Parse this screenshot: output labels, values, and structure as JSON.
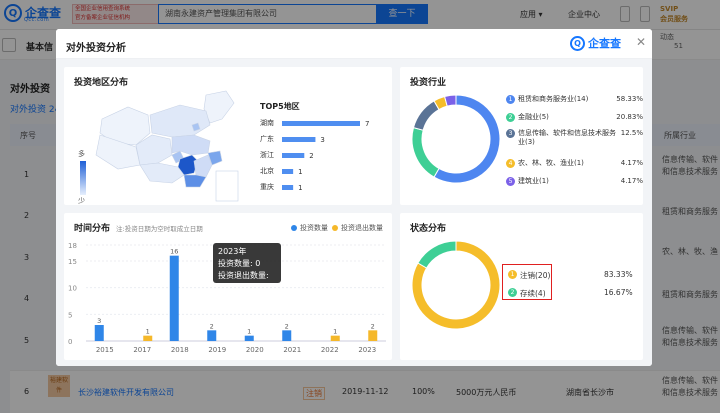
{
  "topbar": {
    "logo_text": "企查查",
    "logo_sub": "Qcc.com",
    "badge_line1": "全国企业信用查询系统",
    "badge_line2": "官方备案企业征信机构",
    "search_value": "湖南永建资产管理集团有限公司",
    "search_button": "查一下",
    "nav_app": "应用",
    "nav_enterprise": "企业中心",
    "svip_line1": "SVIP",
    "svip_line2": "会员服务"
  },
  "background": {
    "basic_info_tab": "基本信",
    "dynamic_label": "动态",
    "dynamic_count": "51",
    "section_title": "对外投资",
    "subtab": "对外投资 24",
    "col_seq": "序号",
    "col_industry": "所属行业",
    "rows": [
      {
        "num": "1",
        "industry": "信息传输、软件和信息技术服务"
      },
      {
        "num": "2",
        "industry": "租赁和商务服务"
      },
      {
        "num": "3",
        "industry": "农、林、牧、渔"
      },
      {
        "num": "4",
        "industry": "租赁和商务服务"
      },
      {
        "num": "5",
        "industry": "信息传输、软件和信息技术服务"
      }
    ],
    "row6": {
      "num": "6",
      "logo": "裕建软件",
      "name": "长沙裕建软件开发有限公司",
      "status": "注销",
      "date": "2019-11-12",
      "ratio": "100%",
      "capital": "5000万元人民币",
      "region": "湖南省长沙市",
      "industry": "信息传输、软件和信息技术服务"
    }
  },
  "modal": {
    "title": "对外投资分析",
    "logo_text": "企查查",
    "close_icon": "close-icon"
  },
  "region": {
    "title": "投资地区分布",
    "legend_high": "多",
    "legend_low": "少",
    "top5_title": "TOP5地区",
    "top5": [
      {
        "name": "湖南",
        "value": 7
      },
      {
        "name": "广东",
        "value": 3
      },
      {
        "name": "浙江",
        "value": 2
      },
      {
        "name": "北京",
        "value": 1
      },
      {
        "name": "重庆",
        "value": 1
      }
    ],
    "map_color": "#4f8ef0"
  },
  "industry": {
    "title": "投资行业",
    "items": [
      {
        "num": "1",
        "label": "租赁和商务服务业(14)",
        "pct": "58.33%",
        "value": 14,
        "color": "#4e86f0"
      },
      {
        "num": "2",
        "label": "金融业(5)",
        "pct": "20.83%",
        "value": 5,
        "color": "#3ecf95"
      },
      {
        "num": "3",
        "label": "信息传输、软件和信息技术服务业(3)",
        "pct": "12.5%",
        "value": 3,
        "color": "#5a7396"
      },
      {
        "num": "4",
        "label": "农、林、牧、渔业(1)",
        "pct": "4.17%",
        "value": 1,
        "color": "#f5bd2a"
      },
      {
        "num": "5",
        "label": "建筑业(1)",
        "pct": "4.17%",
        "value": 1,
        "color": "#7b61e8"
      }
    ]
  },
  "time": {
    "title": "时间分布",
    "note": "注:投资日期为空时取成立日期",
    "legend_invest": "投资数量",
    "legend_exit": "投资退出数量",
    "color_invest": "#2f86e8",
    "color_exit": "#f5b82a",
    "tooltip_year": "2023年",
    "tooltip_invest": "投资数量: 0",
    "tooltip_exit": "投资退出数量: 2"
  },
  "status": {
    "title": "状态分布",
    "items": [
      {
        "num": "1",
        "label": "注销(20)",
        "pct": "83.33%",
        "value": 20,
        "color": "#f5bd2a"
      },
      {
        "num": "2",
        "label": "存续(4)",
        "pct": "16.67%",
        "value": 4,
        "color": "#3ecf95"
      }
    ]
  },
  "chart_data": [
    {
      "type": "bar",
      "title": "TOP5地区",
      "categories": [
        "湖南",
        "广东",
        "浙江",
        "北京",
        "重庆"
      ],
      "values": [
        7,
        3,
        2,
        1,
        1
      ]
    },
    {
      "type": "pie",
      "title": "投资行业",
      "categories": [
        "租赁和商务服务业(14)",
        "金融业(5)",
        "信息传输、软件和信息技术服务业(3)",
        "农、林、牧、渔业(1)",
        "建筑业(1)"
      ],
      "values": [
        14,
        5,
        3,
        1,
        1
      ]
    },
    {
      "type": "bar",
      "title": "时间分布",
      "categories": [
        "2015",
        "2017",
        "2018",
        "2019",
        "2020",
        "2021",
        "2022",
        "2023"
      ],
      "series": [
        {
          "name": "投资数量",
          "values": [
            3,
            0,
            16,
            2,
            1,
            2,
            0,
            0
          ]
        },
        {
          "name": "投资退出数量",
          "values": [
            0,
            1,
            0,
            0,
            0,
            0,
            1,
            2
          ]
        }
      ],
      "yticks": [
        "0",
        "5",
        "10",
        "15",
        "18"
      ],
      "ylim": [
        0,
        18
      ],
      "legend": "top-right"
    },
    {
      "type": "pie",
      "title": "状态分布",
      "categories": [
        "注销(20)",
        "存续(4)"
      ],
      "values": [
        20,
        4
      ]
    }
  ]
}
